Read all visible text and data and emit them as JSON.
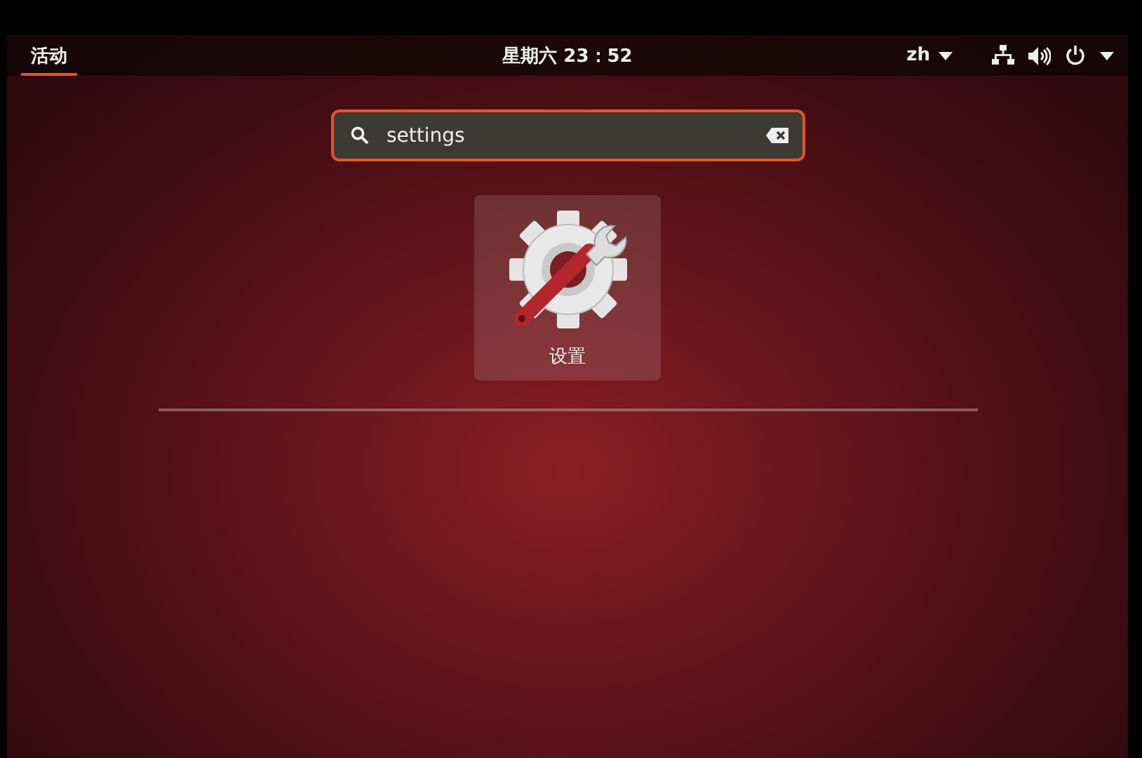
{
  "top_bar": {
    "activities": {
      "label": "活动",
      "selected": true
    },
    "clock": "星期六 23：52",
    "input_source": "zh"
  },
  "search": {
    "value": "settings"
  },
  "results": [
    {
      "label": "设置",
      "selected": true
    }
  ]
}
